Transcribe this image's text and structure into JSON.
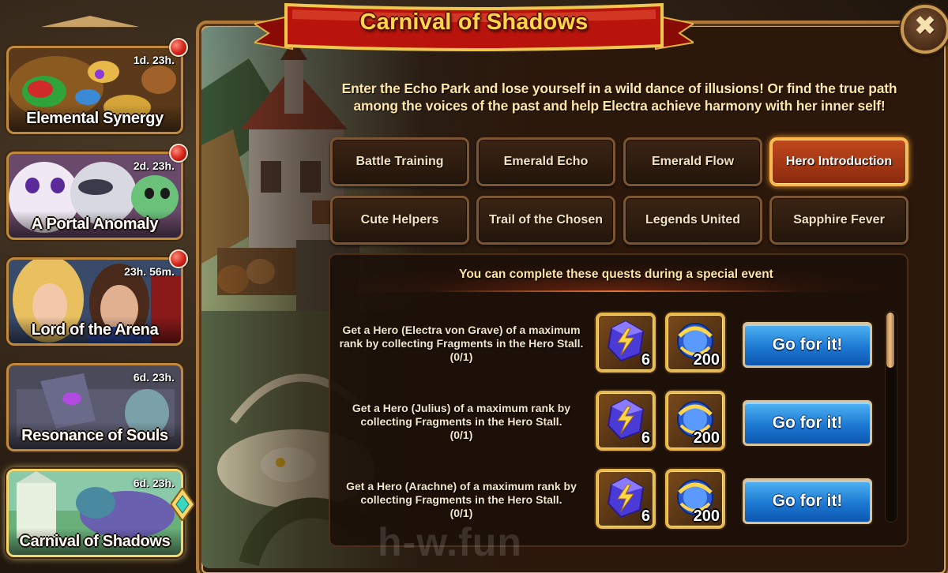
{
  "title": "Carnival of Shadows",
  "description": "Enter the Echo Park and lose yourself in a wild dance of illusions! Or find the true path among the voices of the past and help Electra achieve harmony with her inner self!",
  "close_label": "✖",
  "events": [
    {
      "name": "Elemental Synergy",
      "timer": "1d. 23h.",
      "notification": true
    },
    {
      "name": "A Portal Anomaly",
      "timer": "2d. 23h.",
      "notification": true
    },
    {
      "name": "Lord of the Arena",
      "timer": "23h. 56m.",
      "notification": true
    },
    {
      "name": "Resonance of Souls",
      "timer": "6d. 23h.",
      "notification": false
    },
    {
      "name": "Carnival of Shadows",
      "timer": "6d. 23h.",
      "notification": false,
      "selected": true
    }
  ],
  "tabs": [
    {
      "label": "Battle Training",
      "active": false
    },
    {
      "label": "Emerald Echo",
      "active": false
    },
    {
      "label": "Emerald Flow",
      "active": false
    },
    {
      "label": "Hero Introduction",
      "active": true
    },
    {
      "label": "Cute Helpers",
      "active": false
    },
    {
      "label": "Trail of the Chosen",
      "active": false
    },
    {
      "label": "Legends United",
      "active": false
    },
    {
      "label": "Sapphire Fever",
      "active": false
    }
  ],
  "quests_header": "You can complete these quests during a special event",
  "quests": [
    {
      "text": "Get a Hero (Electra von Grave) of a maximum rank by collecting Fragments in the Hero Stall.",
      "progress": "(0/1)",
      "rewards": [
        {
          "icon": "lightning-stone-icon",
          "qty": "6"
        },
        {
          "icon": "blue-emblem-icon",
          "qty": "200"
        }
      ],
      "button": "Go for it!"
    },
    {
      "text": "Get a Hero (Julius) of a maximum rank by collecting Fragments in the Hero Stall.",
      "progress": "(0/1)",
      "rewards": [
        {
          "icon": "lightning-stone-icon",
          "qty": "6"
        },
        {
          "icon": "blue-emblem-icon",
          "qty": "200"
        }
      ],
      "button": "Go for it!"
    },
    {
      "text": "Get a Hero (Arachne) of a maximum rank by collecting Fragments in the Hero Stall.",
      "progress": "(0/1)",
      "rewards": [
        {
          "icon": "lightning-stone-icon",
          "qty": "6"
        },
        {
          "icon": "blue-emblem-icon",
          "qty": "200"
        }
      ],
      "button": "Go for it!"
    }
  ],
  "watermark": "h-w.fun",
  "colors": {
    "title": "#ffd64a",
    "ribbon": "#b8140c",
    "tab_active": "#c0481c",
    "button": "#1d79d3",
    "frame": "#c08a3e"
  }
}
